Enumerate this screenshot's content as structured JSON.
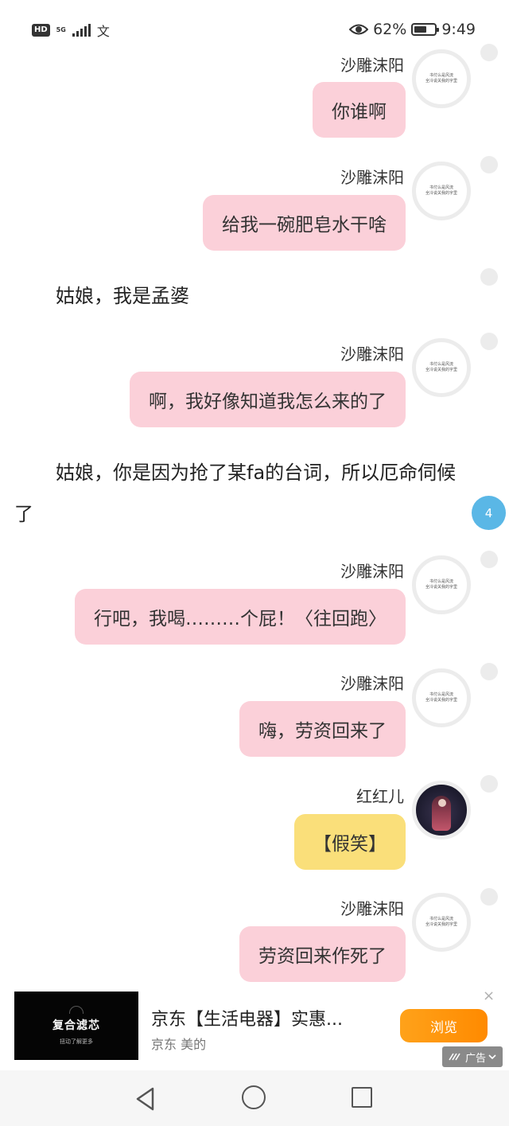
{
  "status_bar": {
    "hd": "HD",
    "network": "5G",
    "misc_icon": "文",
    "battery_percent": "62%",
    "battery_level": 0.62,
    "time": "9:49",
    "icons": [
      "eye-icon",
      "battery-icon",
      "signal-icon"
    ]
  },
  "chat": {
    "messages": [
      {
        "name": "沙雕沫阳",
        "text": "你谁啊"
      },
      {
        "name": "沙雕沫阳",
        "text": "给我一碗肥皂水干啥"
      },
      {
        "narration": "姑娘，我是孟婆"
      },
      {
        "name": "沙雕沫阳",
        "text": "啊，我好像知道我怎么来的了"
      },
      {
        "narration": "姑娘，你是因为抢了某fa的台词，所以厄命伺候了"
      },
      {
        "name": "沙雕沫阳",
        "text": "行吧，我喝………个屁！〈往回跑〉"
      },
      {
        "name": "沙雕沫阳",
        "text": "嗨，劳资回来了"
      },
      {
        "name": "红红儿",
        "text": "【假笑】"
      },
      {
        "name": "沙雕沫阳",
        "text": "劳资回来作死了"
      }
    ],
    "avatar_text": [
      "书付么是风流",
      "全冷说关我的字里"
    ],
    "comment_count": "4",
    "colors": {
      "pink_bubble": "#fbd0d9",
      "yellow_bubble": "#fadf7a",
      "badge": "#5ab7e6"
    }
  },
  "ad": {
    "thumb_title": "复合滤芯",
    "thumb_sub": "扭动了解更多",
    "title": "京东【生活电器】实惠...",
    "subtitle": "京东 美的",
    "button": "浏览",
    "label": "广告",
    "close": "×"
  }
}
